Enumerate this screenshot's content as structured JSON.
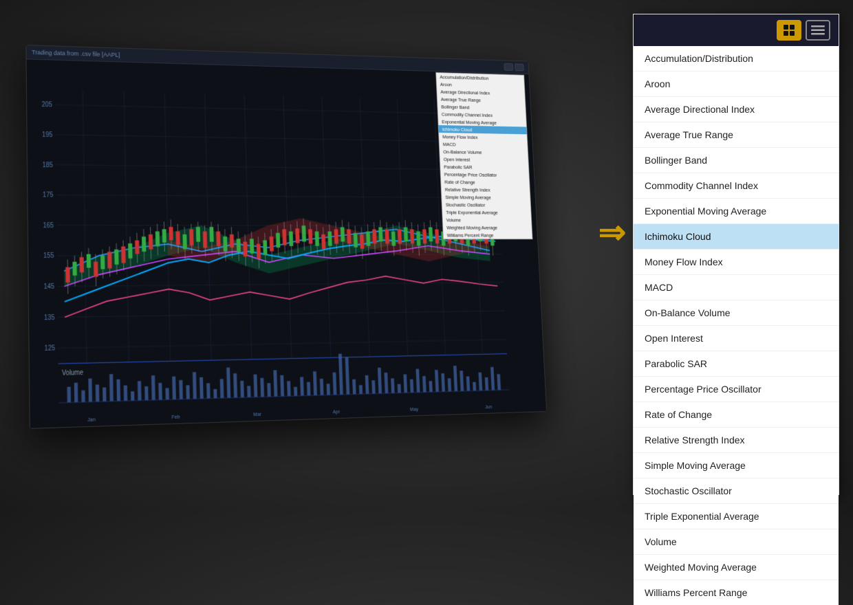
{
  "chart": {
    "title": "Trading data from .csv file [AAPL]",
    "subtitle": "Trading data from .csv file [AAPL]"
  },
  "mini_dropdown": {
    "items": [
      "Accumulation/Distribution",
      "Aroon",
      "Average Directional Index",
      "Average True Range",
      "Bollinger Band",
      "Commodity Channel Index",
      "Exponential Moving Average",
      "Ichimoku Cloud",
      "Money Flow Index",
      "MACD",
      "On-Balance Volume",
      "Open Interest",
      "Parabolic SAR",
      "Percentage Price Oscillator",
      "Rate of Change",
      "Relative Strength Index",
      "Simple Moving Average",
      "Stochastic Oscillator",
      "Triple Exponential Average",
      "Volume",
      "Weighted Moving Average",
      "Williams Percent Range"
    ],
    "selected": "Ichimoku Cloud"
  },
  "indicator_list": {
    "items": [
      "Accumulation/Distribution",
      "Aroon",
      "Average Directional Index",
      "Average True Range",
      "Bollinger Band",
      "Commodity Channel Index",
      "Exponential Moving Average",
      "Ichimoku Cloud",
      "Money Flow Index",
      "MACD",
      "On-Balance Volume",
      "Open Interest",
      "Parabolic SAR",
      "Percentage Price Oscillator",
      "Rate of Change",
      "Relative Strength Index",
      "Simple Moving Average",
      "Stochastic Oscillator",
      "Triple Exponential Average",
      "Volume",
      "Weighted Moving Average",
      "Williams Percent Range"
    ],
    "selected": "Ichimoku Cloud"
  },
  "arrow": "⇒",
  "toolbar": {
    "grid_icon": "▦",
    "menu_icon": "≡"
  }
}
